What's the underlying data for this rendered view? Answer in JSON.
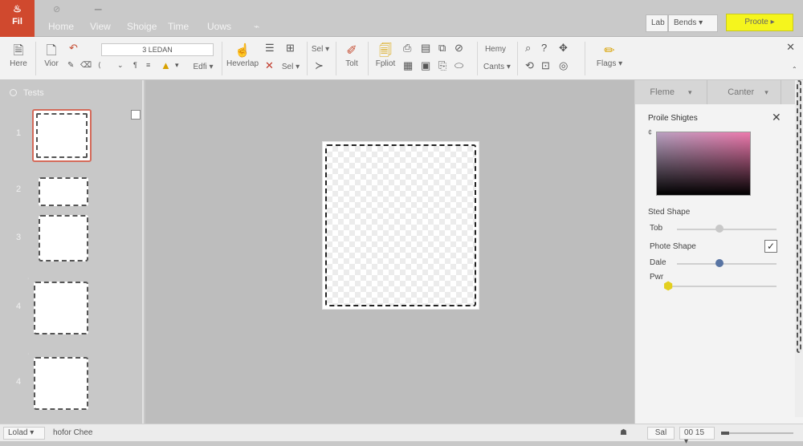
{
  "app": {
    "file_tab": {
      "logo": "♨",
      "label": "Fil"
    },
    "menu": [
      "Home",
      "View",
      "Shoige",
      "Time",
      "Uows"
    ],
    "quick_icons": [
      "⊘",
      "▁"
    ],
    "right_controls": {
      "left_select": "Lab",
      "right_select": "Bends ▾",
      "promote": "Proote ▸"
    }
  },
  "ribbon": {
    "font_box": "3 LEDAN",
    "groups": [
      {
        "id": "here",
        "label": "Here"
      },
      {
        "id": "vior",
        "label": "Vior"
      },
      {
        "id": "edit",
        "label": "Edfi ▾"
      },
      {
        "id": "heverlap",
        "label": "Heverlap"
      },
      {
        "id": "sel",
        "label": "Sel ▾"
      },
      {
        "id": "tolt",
        "label": "Tolt"
      },
      {
        "id": "fpliot",
        "label": "Fpliot"
      },
      {
        "id": "cants",
        "label": "Cants ▾"
      },
      {
        "id": "flags",
        "label": "Flags ▾"
      }
    ],
    "mini_labels": {
      "sel_top": "Sel ▾",
      "hemy": "Hemy"
    },
    "close": "✕"
  },
  "left_panel": {
    "title": "Tests",
    "slide_numbers": [
      "1",
      "2",
      "3",
      "4",
      "4"
    ]
  },
  "right_panel": {
    "tabs": [
      "Fleme",
      "Canter"
    ],
    "heading": "Proile Shigtes",
    "mini_glyph": "¢",
    "close": "✕",
    "section": "Sted Shape",
    "sliders": [
      {
        "label": "Tob",
        "value": 0.43,
        "color": "#c8c8c8"
      },
      {
        "label": "Dale",
        "value": 0.43,
        "color": "#5874a3"
      },
      {
        "label": "Pwr",
        "value": 0.0,
        "color": "#e3cf1f"
      }
    ],
    "checkbox_label": "Phote Shape",
    "checkbox_mark": "✓",
    "colors": {
      "swatch_from": "#b9a1c1",
      "swatch_to": "#ee79ad"
    }
  },
  "status": {
    "left_box": "Lolad ▾",
    "text": "hofor Chee",
    "person_glyph": "☗",
    "sal": "Sal",
    "zoom": "00 15 ▾"
  }
}
